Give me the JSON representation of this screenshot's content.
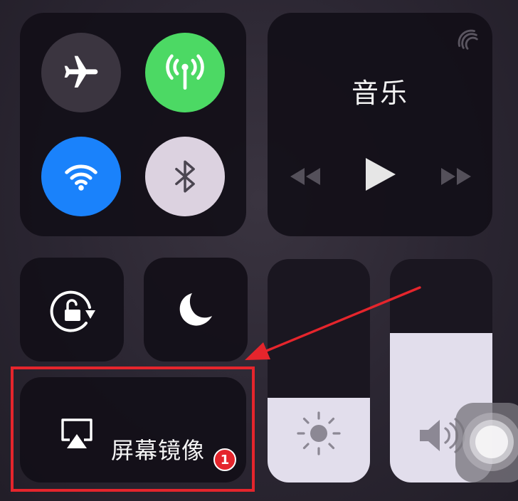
{
  "music": {
    "title": "音乐"
  },
  "screen_mirroring": {
    "label": "屏幕镜像",
    "badge": "1"
  },
  "sliders": {
    "brightness_level": 0.38,
    "volume_level": 0.67
  },
  "colors": {
    "cellular_active": "#4cd964",
    "wifi_active": "#1a82fb",
    "bluetooth_inactive": "#dcd2e0",
    "annotation_red": "#e5252c"
  },
  "icons": {
    "airplane": "airplane-icon",
    "cellular": "cellular-antenna-icon",
    "wifi": "wifi-icon",
    "bluetooth": "bluetooth-icon",
    "rotation_lock": "rotation-lock-icon",
    "do_not_disturb": "moon-icon",
    "airplay": "airplay-icon",
    "brightness": "sun-icon",
    "volume": "speaker-icon"
  }
}
